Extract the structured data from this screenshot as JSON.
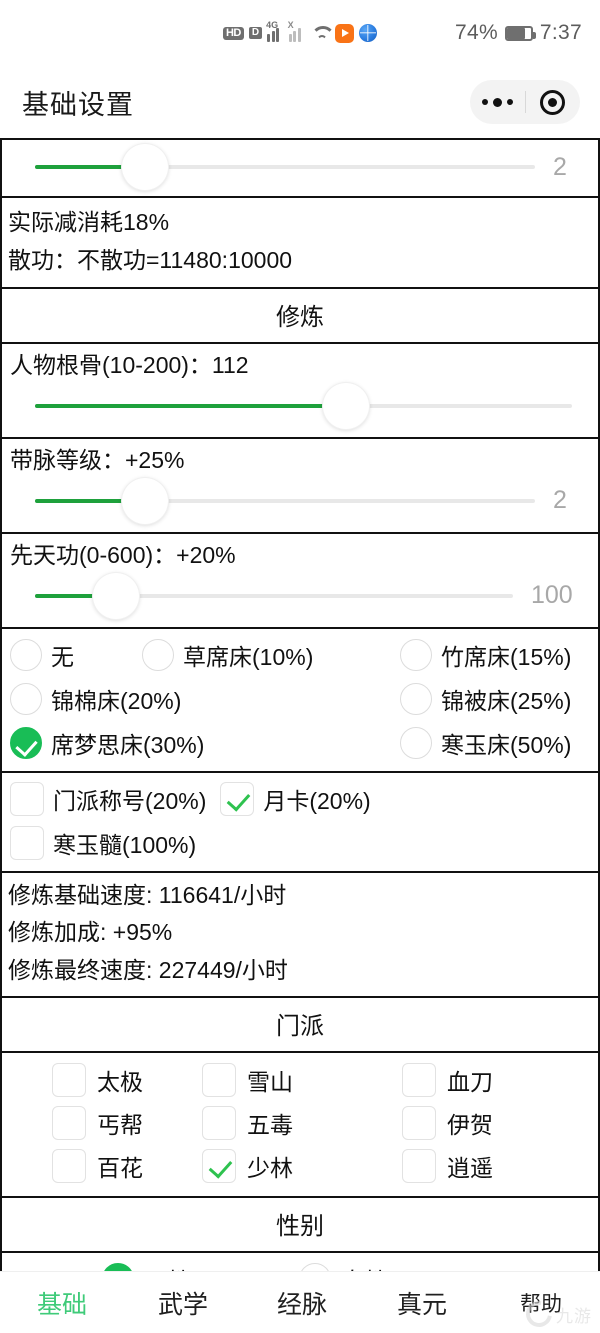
{
  "status_bar": {
    "hd_label": "HD",
    "data_label": "D",
    "net_label": "4G",
    "net_label2": "X",
    "battery_percent": "74%",
    "time": "7:37"
  },
  "app_bar": {
    "title": "基础设置"
  },
  "sliders": {
    "top_partial": {
      "value_label": "2",
      "fill_percent": 22,
      "thumb_percent": 22
    },
    "gengu": {
      "label": "人物根骨(10-200)：112",
      "value_label": "",
      "fill_percent": 58,
      "thumb_percent": 58
    },
    "daimai": {
      "label": "带脉等级：+25%",
      "value_label": "2",
      "fill_percent": 22,
      "thumb_percent": 22
    },
    "xiantian": {
      "label": "先天功(0-600)：+20%",
      "value_label": "100",
      "fill_percent": 17,
      "thumb_percent": 17
    }
  },
  "info_block_1": {
    "line1": "实际减消耗18%",
    "line2": "散功：不散功=11480:10000"
  },
  "sections": {
    "xiulian": "修炼",
    "menpai": "门派",
    "xingbie": "性别"
  },
  "beds": {
    "rows": [
      [
        {
          "label": "无",
          "checked": false
        },
        {
          "label": "草席床(10%)",
          "checked": false
        },
        {
          "label": "竹席床(15%)",
          "checked": false
        }
      ],
      [
        {
          "label": "锦棉床(20%)",
          "checked": false
        },
        {
          "label": "",
          "checked": null
        },
        {
          "label": "锦被床(25%)",
          "checked": false
        }
      ],
      [
        {
          "label": "席梦思床(30%)",
          "checked": true
        },
        {
          "label": "",
          "checked": null
        },
        {
          "label": "寒玉床(50%)",
          "checked": false
        }
      ]
    ]
  },
  "buffs": {
    "row1": [
      {
        "label": "门派称号(20%)",
        "checked": false
      },
      {
        "label": "月卡(20%)",
        "checked": true
      }
    ],
    "row2": [
      {
        "label": "寒玉髓(100%)",
        "checked": false
      }
    ]
  },
  "stats": {
    "base_speed": "修炼基础速度: 116641/小时",
    "bonus": "修炼加成: +95%",
    "final_speed": "修炼最终速度: 227449/小时"
  },
  "sects": {
    "rows": [
      [
        {
          "label": "太极",
          "checked": false
        },
        {
          "label": "雪山",
          "checked": false
        },
        {
          "label": "血刀",
          "checked": false
        }
      ],
      [
        {
          "label": "丐帮",
          "checked": false
        },
        {
          "label": "五毒",
          "checked": false
        },
        {
          "label": "伊贺",
          "checked": false
        }
      ],
      [
        {
          "label": "百花",
          "checked": false
        },
        {
          "label": "少林",
          "checked": true
        },
        {
          "label": "逍遥",
          "checked": false
        }
      ]
    ]
  },
  "gender": {
    "options": [
      {
        "label": "男性",
        "checked": true
      },
      {
        "label": "女性",
        "checked": false
      }
    ]
  },
  "tabs": [
    {
      "label": "基础",
      "active": true
    },
    {
      "label": "武学",
      "active": false
    },
    {
      "label": "经脉",
      "active": false
    },
    {
      "label": "真元",
      "active": false
    },
    {
      "label": "帮助",
      "active": false
    }
  ],
  "watermark": {
    "text": "九游"
  },
  "colors": {
    "green": "#19bd56",
    "slider_green": "#1ea13c",
    "tab_active": "#3fcb79"
  }
}
